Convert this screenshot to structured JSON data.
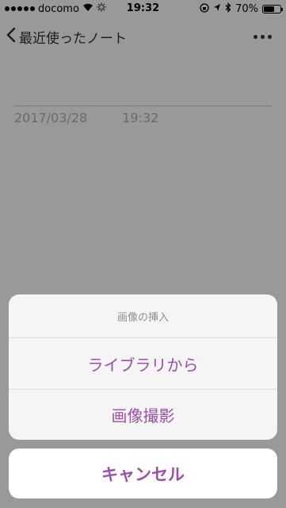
{
  "status_bar": {
    "carrier": "docomo",
    "time": "19:32",
    "battery_text": "70%",
    "battery_level": 0.7
  },
  "nav": {
    "back_label": "最近使ったノート"
  },
  "note": {
    "date": "2017/03/28",
    "time": "19:32"
  },
  "action_sheet": {
    "title": "画像の挿入",
    "options": [
      {
        "label": "ライブラリから"
      },
      {
        "label": "画像撮影"
      }
    ],
    "cancel_label": "キャンセル"
  },
  "colors": {
    "accent": "#9b4fa8",
    "overlay": "rgba(0,0,0,0.4)",
    "sheet_background": "#f8f8f8"
  }
}
